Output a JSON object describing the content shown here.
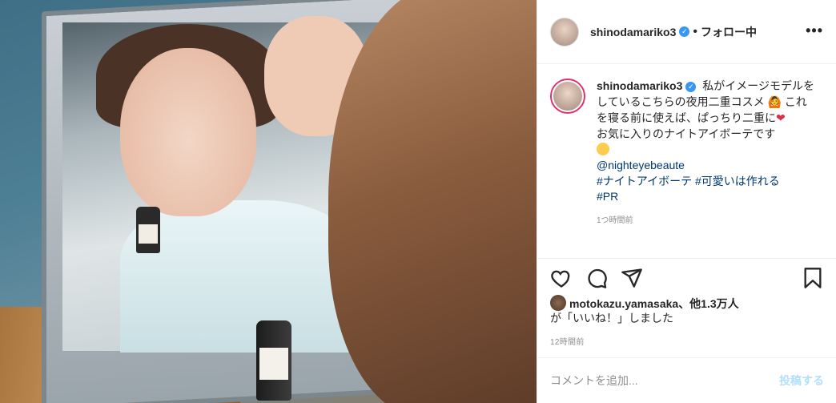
{
  "post": {
    "username": "shinodamariko3",
    "follow_status": "フォロー中",
    "separator": "•",
    "more_label": "•••"
  },
  "caption": {
    "username": "shinodamariko3",
    "line1": " 私がイメージモデルをしているこちらの夜用二重コスメ",
    "line2": " これを寝る前に使えば、ぱっちり二重に",
    "line3": "お気に入りのナイトアイボーテです",
    "mention": "@nighteyebeaute",
    "hashtags": [
      "#ナイトアイボーテ",
      "#可愛いは作れる",
      "#PR"
    ],
    "time": "1つ時間前"
  },
  "likes": {
    "liker": "motokazu.yamasaka",
    "others": "、他1.3万人",
    "suffix": "が「いいね！」しました"
  },
  "posted": "12時間前",
  "comment": {
    "placeholder": "コメントを追加...",
    "post_label": "投稿する"
  },
  "icons": {
    "verified": "verified-badge-icon",
    "like": "heart-icon",
    "comment": "comment-icon",
    "share": "paper-plane-icon",
    "save": "bookmark-icon"
  },
  "colors": {
    "verified": "#3897f0",
    "link": "#00376b",
    "post_button": "#b2dffc",
    "story_ring": "#e1306c"
  }
}
